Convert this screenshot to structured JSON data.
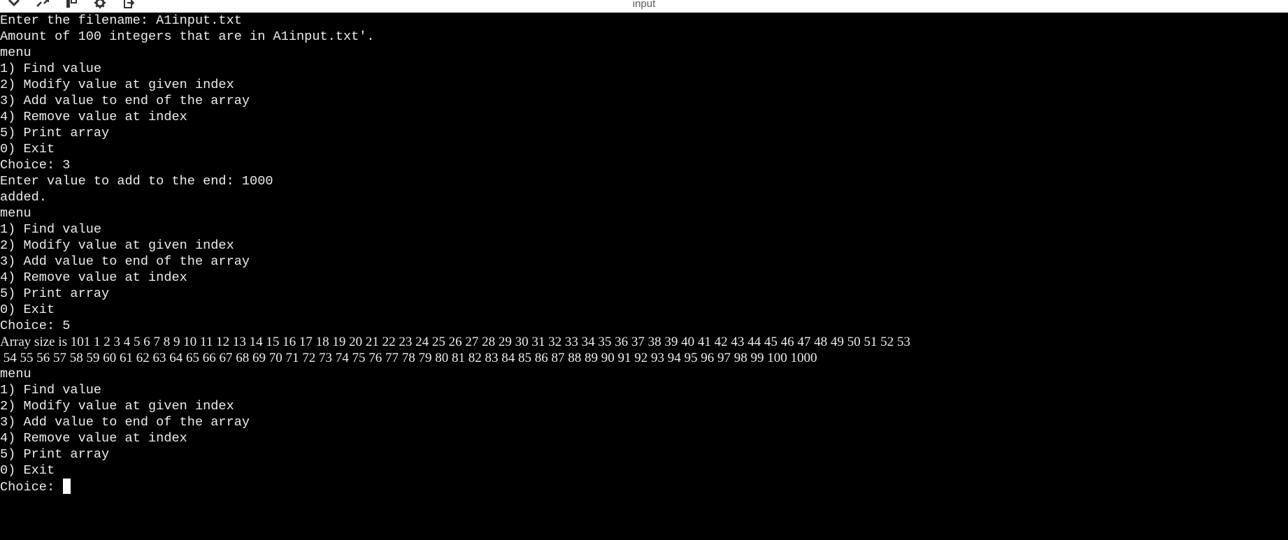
{
  "window": {
    "title": "input",
    "toolbar_icons": [
      "chevron-down-icon",
      "expand-icon",
      "panel-icon",
      "gear-icon",
      "exit-icon"
    ]
  },
  "terminal": {
    "lines": [
      "Enter the filename: A1input.txt",
      "Amount of 100 integers that are in A1input.txt'.",
      "menu",
      "1) Find value",
      "2) Modify value at given index",
      "3) Add value to end of the array",
      "4) Remove value at index",
      "5) Print array",
      "0) Exit",
      "Choice: 3",
      "Enter value to add to the end: 1000",
      "added.",
      "menu",
      "1) Find value",
      "2) Modify value at given index",
      "3) Add value to end of the array",
      "4) Remove value at index",
      "5) Print array",
      "0) Exit",
      "Choice: 5"
    ],
    "array_output_1": "Array size is 101 1 2 3 4 5 6 7 8 9 10 11 12 13 14 15 16 17 18 19 20 21 22 23 24 25 26 27 28 29 30 31 32 33 34 35 36 37 38 39 40 41 42 43 44 45 46 47 48 49 50 51 52 53",
    "array_output_2": " 54 55 56 57 58 59 60 61 62 63 64 65 66 67 68 69 70 71 72 73 74 75 76 77 78 79 80 81 82 83 84 85 86 87 88 89 90 91 92 93 94 95 96 97 98 99 100 1000",
    "lines_after": [
      "menu",
      "1) Find value",
      "2) Modify value at given index",
      "3) Add value to end of the array",
      "4) Remove value at index",
      "5) Print array",
      "0) Exit"
    ],
    "prompt": "Choice: "
  }
}
